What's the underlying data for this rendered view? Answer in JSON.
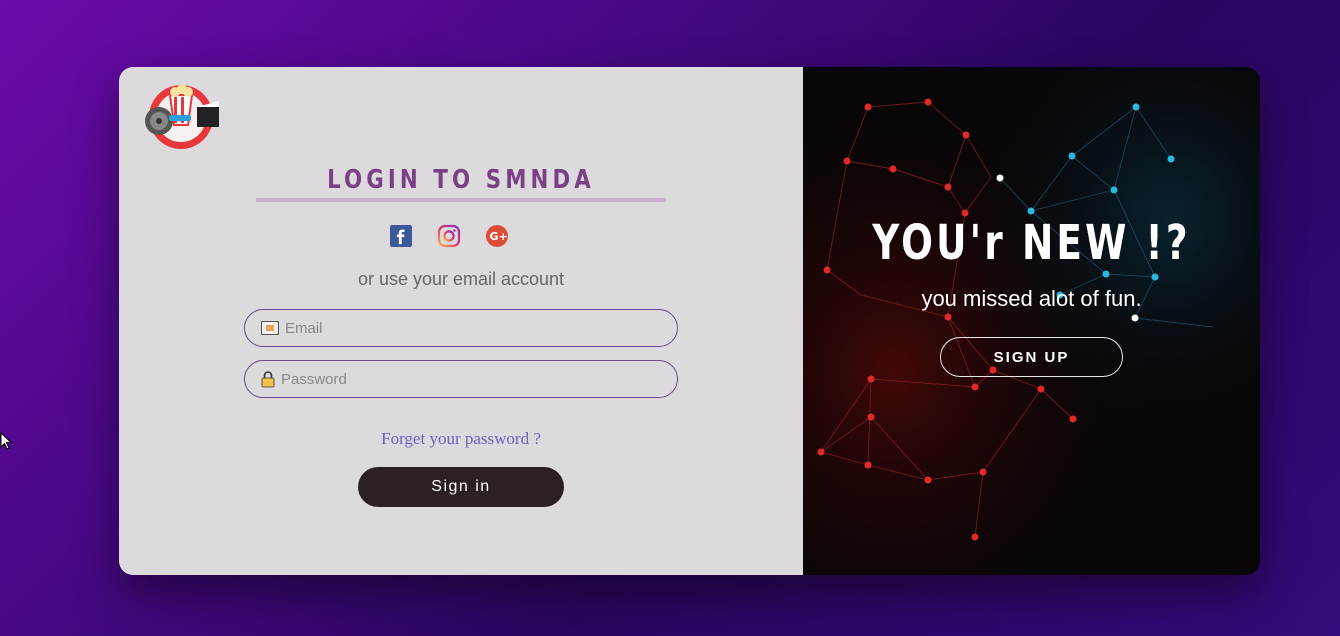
{
  "login": {
    "title": "LOGIN TO SMNDA",
    "alt_text": "or use your email account",
    "email_placeholder": "Email",
    "password_placeholder": "Password",
    "forgot_label": "Forget your password ?",
    "signin_label": "Sign in",
    "socials": [
      "facebook-icon",
      "instagram-icon",
      "google-plus-icon"
    ]
  },
  "promo": {
    "title": "YOU'r NEW !?",
    "subtitle": "you missed alot of fun.",
    "signup_label": "SIGN UP"
  },
  "colors": {
    "title": "#7b3f86",
    "signin_bg": "#2a1e27",
    "forgot_link": "#6f5fc0",
    "field_border": "#6b4a8c"
  }
}
